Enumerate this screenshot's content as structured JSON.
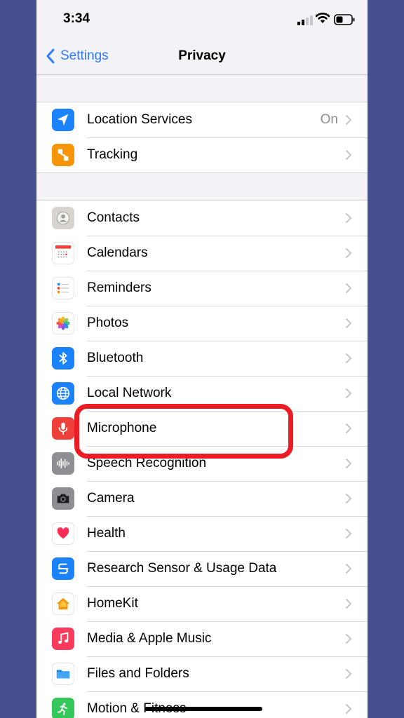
{
  "status": {
    "time": "3:34"
  },
  "nav": {
    "back_label": "Settings",
    "title": "Privacy"
  },
  "colors": {
    "accent": "#2f7cf6",
    "highlight": "#ec1c24",
    "frame_bg": "#46508f"
  },
  "group1": [
    {
      "label": "Location Services",
      "value": "On",
      "icon": "location-arrow-icon"
    },
    {
      "label": "Tracking",
      "icon": "tracking-icon"
    }
  ],
  "group2": [
    {
      "label": "Contacts",
      "icon": "contacts-icon"
    },
    {
      "label": "Calendars",
      "icon": "calendar-icon"
    },
    {
      "label": "Reminders",
      "icon": "reminders-icon"
    },
    {
      "label": "Photos",
      "icon": "photos-icon"
    },
    {
      "label": "Bluetooth",
      "icon": "bluetooth-icon"
    },
    {
      "label": "Local Network",
      "icon": "globe-icon"
    },
    {
      "label": "Microphone",
      "icon": "microphone-icon"
    },
    {
      "label": "Speech Recognition",
      "icon": "waveform-icon"
    },
    {
      "label": "Camera",
      "icon": "camera-icon"
    },
    {
      "label": "Health",
      "icon": "heart-icon"
    },
    {
      "label": "Research Sensor & Usage Data",
      "icon": "research-icon"
    },
    {
      "label": "HomeKit",
      "icon": "house-icon"
    },
    {
      "label": "Media & Apple Music",
      "icon": "music-note-icon"
    },
    {
      "label": "Files and Folders",
      "icon": "folder-icon"
    },
    {
      "label": "Motion & Fitness",
      "icon": "running-figure-icon"
    }
  ]
}
